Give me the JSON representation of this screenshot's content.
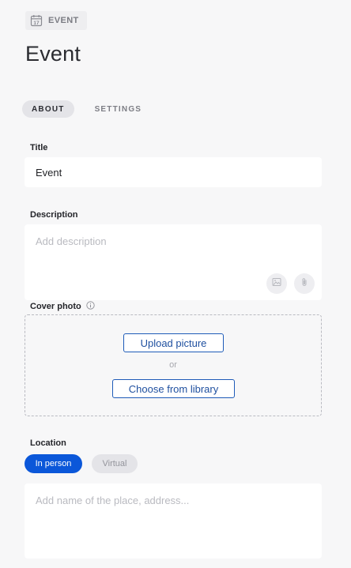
{
  "breadcrumb": {
    "label": "EVENT",
    "icon": "calendar-icon",
    "icon_day": "17"
  },
  "page": {
    "title": "Event"
  },
  "tabs": [
    {
      "label": "ABOUT",
      "active": true
    },
    {
      "label": "SETTINGS",
      "active": false
    }
  ],
  "form": {
    "title": {
      "label": "Title",
      "value": "Event"
    },
    "description": {
      "label": "Description",
      "placeholder": "Add description",
      "icons": [
        "image-icon",
        "paperclip-icon"
      ]
    },
    "cover_photo": {
      "label": "Cover photo",
      "info_icon": "info-icon",
      "upload_label": "Upload picture",
      "or_text": "or",
      "library_label": "Choose from library"
    },
    "location": {
      "label": "Location",
      "options": [
        {
          "label": "In person",
          "selected": true
        },
        {
          "label": "Virtual",
          "selected": false
        }
      ],
      "placeholder": "Add name of the place, address..."
    }
  },
  "colors": {
    "accent": "#0b57d9",
    "link_border": "#1e5bb8",
    "background": "#f7f7f8"
  }
}
